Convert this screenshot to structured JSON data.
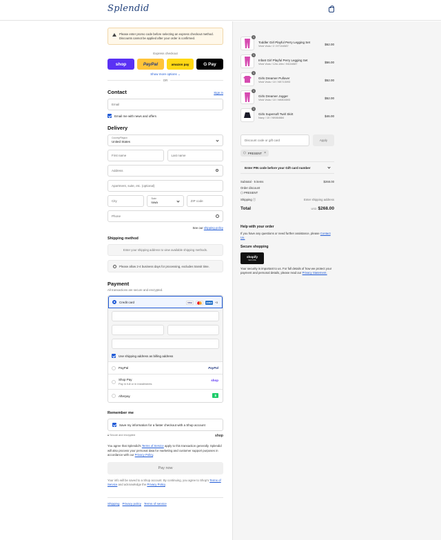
{
  "header": {
    "logo": "Splendid",
    "cart_icon": "shopping-bag-icon"
  },
  "notice": "Please enter promo code before selecting an express checkout method. Discounts cannot be applied after your order is confirmed.",
  "express": {
    "title": "Express checkout",
    "buttons": {
      "shop": "shop",
      "paypal": "PayPal",
      "amazon": "amazon pay",
      "gpay": "G Pay"
    },
    "more": "Show more options ⌄",
    "or": "OR"
  },
  "contact": {
    "title": "Contact",
    "signin": "Sign in",
    "email_placeholder": "Email",
    "newsletter": "Email me with news and offers"
  },
  "delivery": {
    "title": "Delivery",
    "country_label": "Country/Region",
    "country_value": "United States",
    "first_name": "First name",
    "last_name": "Last name",
    "address": "Address",
    "apartment": "Apartment, suite, etc. (optional)",
    "city": "City",
    "state_label": "State",
    "state_value": "Iowa",
    "zip": "ZIP code",
    "phone": "Phone",
    "policy_prefix": "See our",
    "policy_link": "shipping policy"
  },
  "shipping_method": {
    "title": "Shipping method",
    "placeholder": "Enter your shipping address to view available shipping methods.",
    "note": "Please allow 2-4 business days for processing, excludes transit time."
  },
  "payment": {
    "title": "Payment",
    "subtitle": "All transactions are secure and encrypted.",
    "credit_card": "Credit card",
    "card_brands": [
      "VISA",
      "MC",
      "AMEX"
    ],
    "more_cards": "+3",
    "billing_same": "Use shipping address as billing address",
    "paypal": "PayPal",
    "paypal_brand": "PayPal",
    "shoppay": "Shop Pay",
    "shoppay_sub": "Pay in full or in installments",
    "shoppay_brand": "shop",
    "afterpay": "Afterpay",
    "afterpay_brand": "$"
  },
  "remember": {
    "title": "Remember me",
    "save": "Save my information for a faster checkout with a Shop account",
    "secure": "Secure and encrypted",
    "shop_brand": "shop"
  },
  "terms": {
    "t1": "You agree that Splendid's",
    "tos_link": "Terms of Service",
    "t2": "apply to this transaction generally. Splendid will also process your personal data for marketing and customer support purposes in accordance with our",
    "privacy_link": "Privacy Policy",
    "t3": "."
  },
  "pay_now": "Pay now",
  "fine_print": {
    "t1": "Your info will be saved to a Shop account. By continuing, you agree to Shop's",
    "tos_link": "Terms of Service",
    "t2": "and acknowledge the",
    "privacy_link": "Privacy Policy",
    "t3": "."
  },
  "footer": {
    "shipping": "Shipping",
    "privacy": "Privacy policy",
    "terms": "Terms of service"
  },
  "cart": {
    "items": [
      {
        "qty": "1",
        "name": "Toddler Girl Playful Perry Legging Set",
        "variant": "Vivid Viola / 2 / KT104587",
        "price": "$62.00",
        "color": "#d64ab0"
      },
      {
        "qty": "1",
        "name": "Infant Girl Playful Perry Legging Set",
        "variant": "Vivid Viola / 12m-18m / IN104587",
        "price": "$56.00",
        "color": "#d64ab0"
      },
      {
        "qty": "1",
        "name": "Girls Dreamer Pullover",
        "variant": "Vivid Viola / 10 / NK713093",
        "price": "$52.00",
        "color": "#d64ab0"
      },
      {
        "qty": "1",
        "name": "Girls Dreamer Jogger",
        "variant": "Vivid Viola / 10 / NK804593",
        "price": "$52.00",
        "color": "#d64ab0"
      },
      {
        "qty": "1",
        "name": "Girls Supersoft Twirl Skirt",
        "variant": "Navy / 10 / NK664684",
        "price": "$46.00",
        "color": "#1c1c2a"
      }
    ],
    "discount_placeholder": "Discount code or gift card",
    "apply": "Apply",
    "chip": "PRESENT",
    "pin": "Enter PIN code before your Gift card number",
    "subtotal_label": "Subtotal · 5 items",
    "subtotal_value": "$268.00",
    "order_discount": "Order discount",
    "discount_code": "PRESENT",
    "shipping_label": "Shipping ⓘ",
    "shipping_value": "Enter shipping address",
    "total_label": "Total",
    "currency": "USD",
    "total_value": "$268.00"
  },
  "help": {
    "title": "Help with your order",
    "text": "If you have any questions or need further assistance, please",
    "link": "Contact Us.",
    "secure_title": "Secure shopping",
    "badge": "shopify",
    "badge_sub": "SECURE",
    "secure_text": "Your security is important to us. For full details of how we protect your payment and personal details, please read our",
    "secure_link": "Privacy Statement."
  },
  "colors": {
    "accent": "#1f5ad6",
    "shop_purple": "#5a31f4",
    "paypal_yellow": "#ffc439",
    "product_pink": "#d64ab0"
  }
}
